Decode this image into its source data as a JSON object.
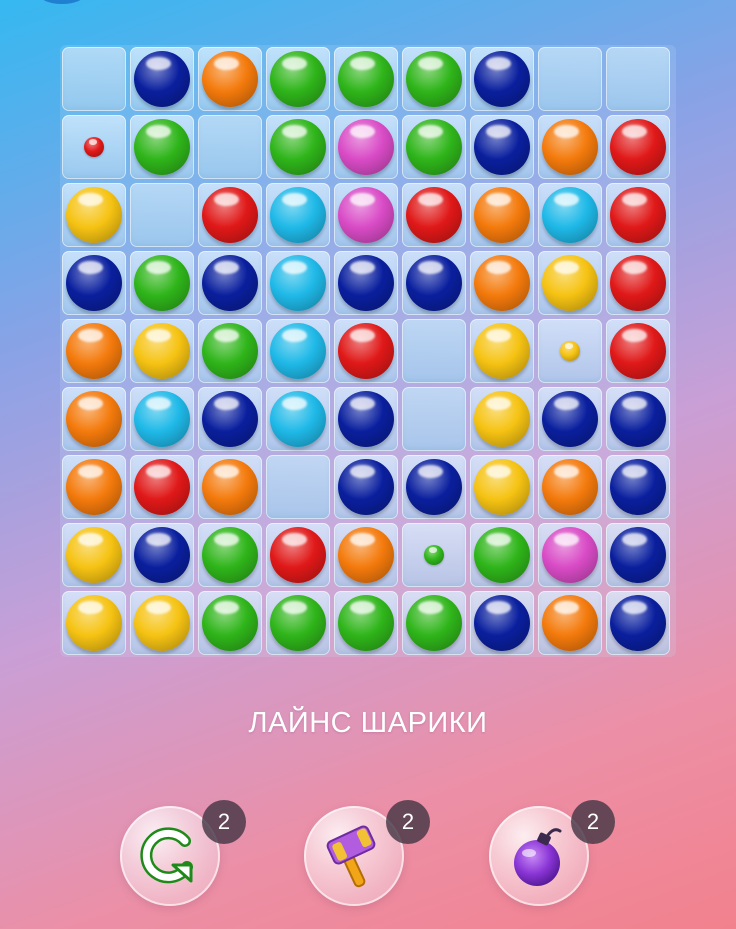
{
  "game": {
    "title": "ЛАЙНС ШАРИКИ"
  },
  "colors": {
    "red": "#e01818",
    "orange": "#f47a0c",
    "yellow": "#f6c313",
    "green": "#2fb51a",
    "cyan": "#1fb9e8",
    "blue": "#0a1f9e",
    "pink": "#d94bc6",
    "purple": "#9b3ee0"
  },
  "board": {
    "rows": 9,
    "cols": 9,
    "cells": [
      [
        "empty",
        "blue",
        "orange",
        "green",
        "green",
        "green",
        "blue",
        "empty",
        "empty"
      ],
      [
        "small:red",
        "green",
        "empty",
        "green",
        "pink",
        "green",
        "blue",
        "orange",
        "red"
      ],
      [
        "yellow",
        "empty",
        "red",
        "cyan",
        "pink",
        "red",
        "orange",
        "cyan",
        "red"
      ],
      [
        "blue",
        "green",
        "blue",
        "cyan",
        "blue",
        "blue",
        "orange",
        "yellow",
        "red"
      ],
      [
        "orange",
        "yellow",
        "green",
        "cyan",
        "red",
        "empty",
        "yellow",
        "small:yellow",
        "red"
      ],
      [
        "orange",
        "cyan",
        "blue",
        "cyan",
        "blue",
        "empty",
        "yellow",
        "blue",
        "blue"
      ],
      [
        "orange",
        "red",
        "orange",
        "empty",
        "blue",
        "blue",
        "yellow",
        "orange",
        "blue"
      ],
      [
        "yellow",
        "blue",
        "green",
        "red",
        "orange",
        "small:green",
        "green",
        "pink",
        "blue"
      ],
      [
        "yellow",
        "yellow",
        "green",
        "green",
        "green",
        "green",
        "blue",
        "orange",
        "blue"
      ]
    ]
  },
  "powerups": [
    {
      "name": "undo",
      "icon": "undo-arrow-icon",
      "count": "2"
    },
    {
      "name": "hammer",
      "icon": "hammer-icon",
      "count": "2"
    },
    {
      "name": "bomb",
      "icon": "bomb-icon",
      "count": "2"
    }
  ]
}
